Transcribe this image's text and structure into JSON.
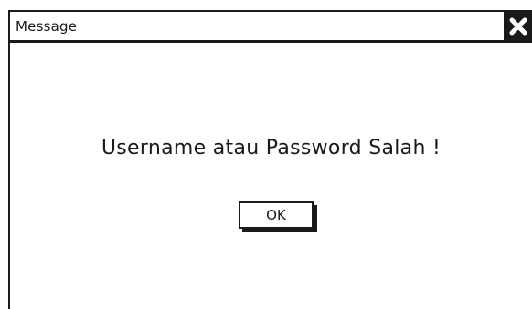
{
  "dialog": {
    "title": "Message",
    "message": "Username atau Password Salah !",
    "ok_label": "OK",
    "close_icon": "close-icon"
  },
  "colors": {
    "ink": "#1a1a1a",
    "background": "#ffffff"
  }
}
